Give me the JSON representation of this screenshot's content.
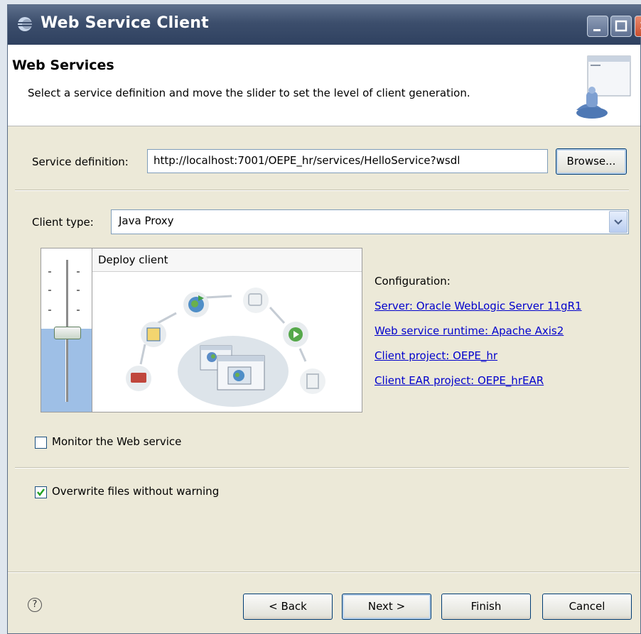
{
  "window": {
    "title": "Web Service Client"
  },
  "header": {
    "title": "Web Services",
    "description": "Select a service definition and move the slider to set the level of client generation."
  },
  "service_definition": {
    "label": "Service definition:",
    "value": "http://localhost:7001/OEPE_hr/services/HelloService?wsdl",
    "browse_label": "Browse..."
  },
  "client_type": {
    "label": "Client type:",
    "value": "Java Proxy"
  },
  "slider": {
    "level_label": "Deploy client"
  },
  "configuration": {
    "heading": "Configuration:",
    "server": "Server: Oracle WebLogic Server 11gR1",
    "runtime": "Web service runtime: Apache Axis2",
    "client_project": "Client project: OEPE_hr",
    "client_ear_project": "Client EAR project: OEPE_hrEAR"
  },
  "options": {
    "monitor_label": "Monitor the Web service",
    "monitor_checked": false,
    "overwrite_label": "Overwrite files without warning",
    "overwrite_checked": true
  },
  "footer": {
    "help_icon": "?",
    "back_label": "< Back",
    "next_label": "Next >",
    "finish_label": "Finish",
    "cancel_label": "Cancel"
  },
  "colors": {
    "titlebar": "#3c4e6c",
    "link": "#0000cc",
    "slider_fill": "#9ebfe6",
    "dialog_bg": "#ece9d8"
  }
}
